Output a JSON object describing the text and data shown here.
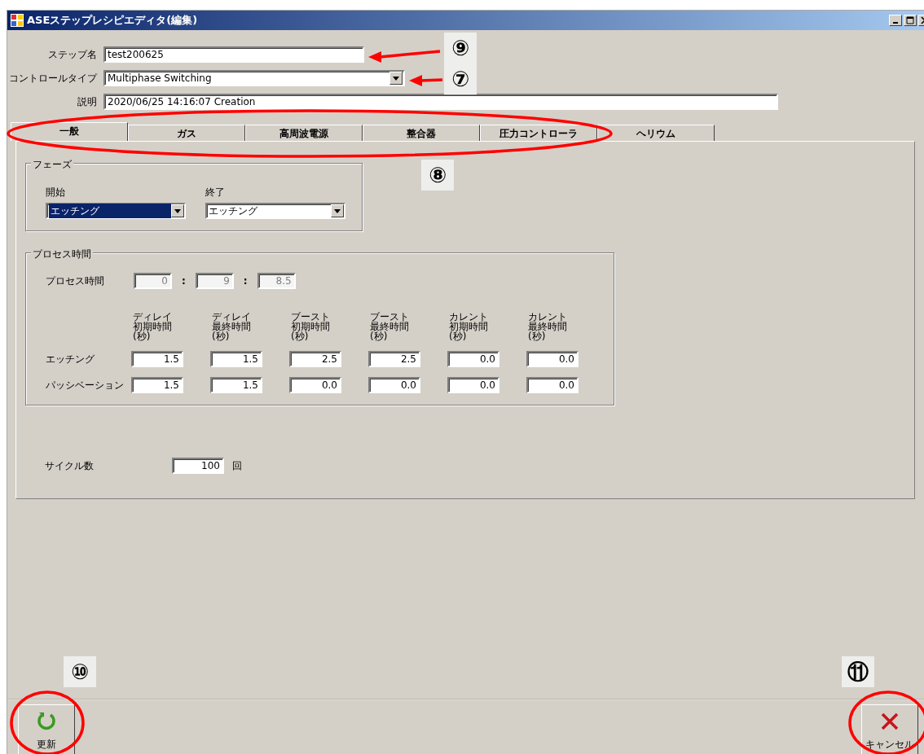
{
  "window": {
    "title": "ASEステップレシピエディタ(編集)"
  },
  "header_fields": [
    {
      "label": "ステップ名",
      "kind": "text",
      "value": "test200625"
    },
    {
      "label": "コントロールタイプ",
      "kind": "select",
      "value": "Multiphase Switching"
    },
    {
      "label": "説明",
      "kind": "text",
      "value": "2020/06/25 14:16:07 Creation"
    }
  ],
  "tabs": [
    {
      "label": "一般",
      "selected": true
    },
    {
      "label": "ガス",
      "selected": false
    },
    {
      "label": "高周波電源",
      "selected": false
    },
    {
      "label": "整合器",
      "selected": false
    },
    {
      "label": "圧力コントローラ",
      "selected": false
    },
    {
      "label": "ヘリウム",
      "selected": false
    }
  ],
  "phase_group": {
    "title": "フェーズ",
    "fields": [
      {
        "label": "開始",
        "value": "エッチング",
        "focused": true
      },
      {
        "label": "終了",
        "value": "エッチング",
        "focused": false
      }
    ]
  },
  "process_group": {
    "title": "プロセス時間",
    "time_label": "プロセス時間",
    "time_fields": [
      {
        "value": "0",
        "disabled": true
      },
      {
        "value": "9",
        "disabled": true
      },
      {
        "value": "8.5",
        "disabled": true
      }
    ],
    "time_separators": [
      ":",
      ":"
    ],
    "columns": [
      [
        "ディレイ",
        "初期時間",
        "(秒)"
      ],
      [
        "ディレイ",
        "最終時間",
        "(秒)"
      ],
      [
        "ブースト",
        "初期時間",
        "(秒)"
      ],
      [
        "ブースト",
        "最終時間",
        "(秒)"
      ],
      [
        "カレント",
        "初期時間",
        "(秒)"
      ],
      [
        "カレント",
        "最終時間",
        "(秒)"
      ]
    ],
    "rows": [
      {
        "label": "エッチング",
        "values": [
          "1.5",
          "1.5",
          "2.5",
          "2.5",
          "0.0",
          "0.0"
        ]
      },
      {
        "label": "パッシベーション",
        "values": [
          "1.5",
          "1.5",
          "0.0",
          "0.0",
          "0.0",
          "0.0"
        ]
      }
    ]
  },
  "cycles": {
    "label": "サイクル数",
    "value": "100",
    "unit": "回"
  },
  "buttons": [
    {
      "label": "更新",
      "kind": "refresh"
    },
    {
      "label": "キャンセル",
      "kind": "cancel"
    }
  ],
  "annotations": [
    {
      "label": "⑨",
      "kind": "arrow"
    },
    {
      "label": "⑦",
      "kind": "arrow"
    },
    {
      "label": "⑧",
      "kind": "ellipse"
    },
    {
      "label": "⑩",
      "kind": "circle"
    },
    {
      "label": "⑪",
      "kind": "circle"
    }
  ]
}
